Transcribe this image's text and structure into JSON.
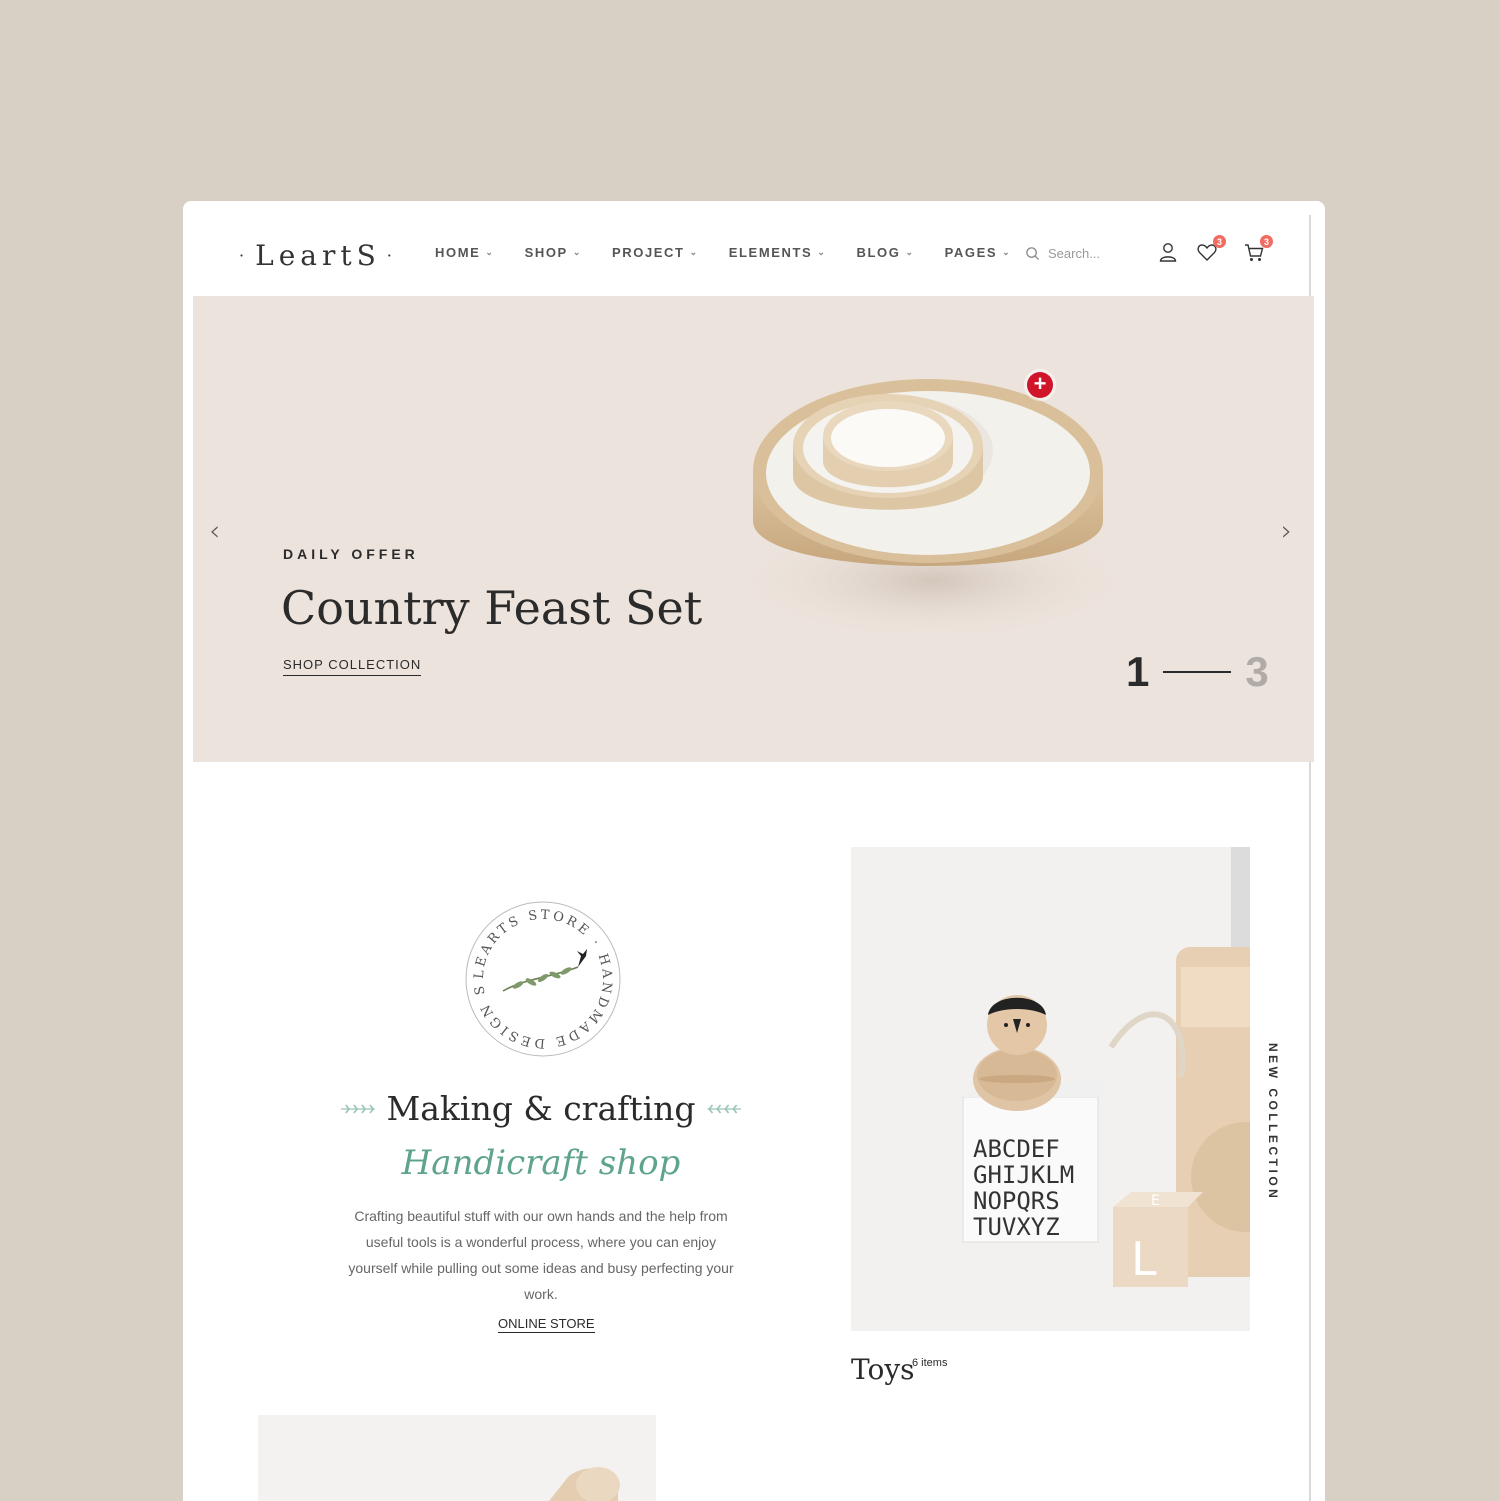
{
  "brand": {
    "logo_text": "LeartS",
    "logo_dot": "·"
  },
  "nav": {
    "items": [
      {
        "label": "HOME"
      },
      {
        "label": "SHOP"
      },
      {
        "label": "PROJECT"
      },
      {
        "label": "ELEMENTS"
      },
      {
        "label": "BLOG"
      },
      {
        "label": "PAGES"
      }
    ],
    "chevron": "⌄"
  },
  "search": {
    "placeholder": "Search..."
  },
  "header_icons": {
    "wishlist_count": "3",
    "cart_count": "3"
  },
  "hero": {
    "eyebrow": "DAILY OFFER",
    "title": "Country Feast Set",
    "link": "SHOP COLLECTION",
    "current_slide": "1",
    "total_slides": "3",
    "prev_arrow": "‹",
    "next_arrow": "›",
    "hotspot": "+"
  },
  "intro": {
    "badge_text": "LEARTS STORE · HANDMADE DESIGN SHOP ·",
    "heading": "Making & crafting",
    "script": "Handicraft shop",
    "description": "Crafting beautiful stuff with our own hands and the help from useful tools is a wonderful process, where you can enjoy yourself while pulling out some ideas and busy perfecting your work.",
    "link": "ONLINE STORE"
  },
  "category": {
    "side_label": "NEW COLLECTION",
    "name": "Toys",
    "count": "6 items",
    "block_letters": [
      "ABCDEF",
      "GHIJKLM",
      "NOPQRS",
      "TUVXYZ"
    ],
    "cube_letter_front": "L",
    "cube_letter_top": "E"
  },
  "colors": {
    "background": "#d8cfc5",
    "hero_bg": "#ece3dc",
    "accent_red": "#d0142a",
    "badge": "#f06b60",
    "script_green": "#5ea48a"
  }
}
